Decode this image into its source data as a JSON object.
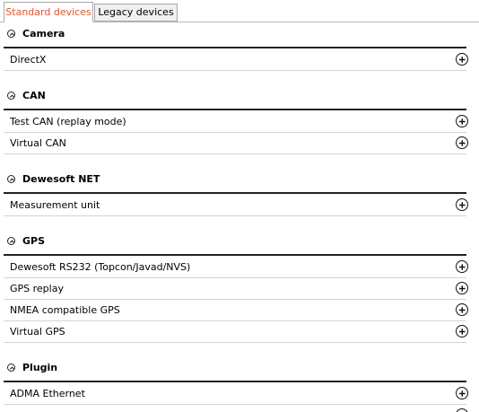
{
  "tabs": [
    {
      "label": "Standard devices",
      "active": true
    },
    {
      "label": "Legacy devices",
      "active": false
    }
  ],
  "accent_color": "#e0552a",
  "sections": [
    {
      "title": "Camera",
      "icon": "chevron-up-icon",
      "items": [
        "DirectX"
      ]
    },
    {
      "title": "CAN",
      "icon": "chevron-up-icon",
      "items": [
        "Test CAN (replay mode)",
        "Virtual CAN"
      ]
    },
    {
      "title": "Dewesoft NET",
      "icon": "chevron-up-icon",
      "items": [
        "Measurement unit"
      ]
    },
    {
      "title": "GPS",
      "icon": "chevron-up-icon",
      "items": [
        "Dewesoft RS232 (Topcon/Javad/NVS)",
        "GPS replay",
        "NMEA compatible GPS",
        "Virtual GPS"
      ]
    },
    {
      "title": "Plugin",
      "icon": "chevron-up-icon",
      "items": [
        "ADMA Ethernet",
        ""
      ]
    }
  ],
  "item_action_icon": "add-circle-icon"
}
